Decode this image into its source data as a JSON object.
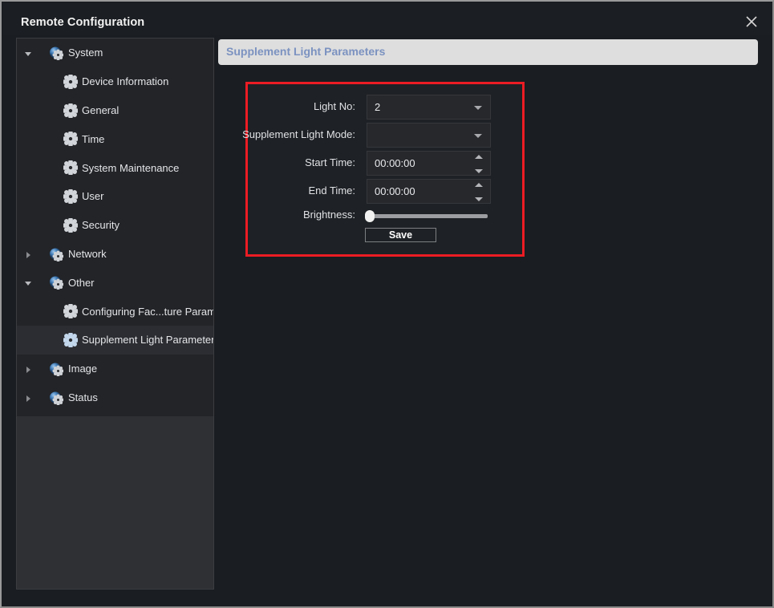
{
  "window": {
    "title": "Remote Configuration",
    "close_icon": "close-icon"
  },
  "sidebar": {
    "items": [
      {
        "label": "System",
        "level": 0,
        "expanded": true,
        "twisty": "chevron-down-icon",
        "icon": "sphere-gear-icon",
        "selected": false
      },
      {
        "label": "Device Information",
        "level": 1,
        "expanded": null,
        "twisty": "",
        "icon": "gear-icon",
        "selected": false
      },
      {
        "label": "General",
        "level": 1,
        "expanded": null,
        "twisty": "",
        "icon": "gear-icon",
        "selected": false
      },
      {
        "label": "Time",
        "level": 1,
        "expanded": null,
        "twisty": "",
        "icon": "gear-icon",
        "selected": false
      },
      {
        "label": "System Maintenance",
        "level": 1,
        "expanded": null,
        "twisty": "",
        "icon": "gear-icon",
        "selected": false
      },
      {
        "label": "User",
        "level": 1,
        "expanded": null,
        "twisty": "",
        "icon": "gear-icon",
        "selected": false
      },
      {
        "label": "Security",
        "level": 1,
        "expanded": null,
        "twisty": "",
        "icon": "gear-icon",
        "selected": false
      },
      {
        "label": "Network",
        "level": 0,
        "expanded": false,
        "twisty": "chevron-right-icon",
        "icon": "sphere-gear-icon",
        "selected": false
      },
      {
        "label": "Other",
        "level": 0,
        "expanded": true,
        "twisty": "chevron-down-icon",
        "icon": "sphere-gear-icon",
        "selected": false
      },
      {
        "label": "Configuring Fac...ture Parameters",
        "level": 1,
        "expanded": null,
        "twisty": "",
        "icon": "gear-icon",
        "selected": false
      },
      {
        "label": "Supplement Light Parameters",
        "level": 1,
        "expanded": null,
        "twisty": "",
        "icon": "gear-icon-blue",
        "selected": true
      },
      {
        "label": "Image",
        "level": 0,
        "expanded": false,
        "twisty": "chevron-right-icon",
        "icon": "sphere-gear-icon",
        "selected": false
      },
      {
        "label": "Status",
        "level": 0,
        "expanded": false,
        "twisty": "chevron-right-icon",
        "icon": "sphere-gear-icon",
        "selected": false
      }
    ]
  },
  "panel": {
    "header_title": "Supplement Light Parameters",
    "header_text_color": "#7b92c0",
    "highlight_border_color": "#ec1c24"
  },
  "form": {
    "light_no": {
      "label": "Light No:",
      "value": "2",
      "icon": "chevron-down-icon"
    },
    "supplement_light_mode": {
      "label": "Supplement Light Mode:",
      "value": "",
      "icon": "chevron-down-icon"
    },
    "start_time": {
      "label": "Start Time:",
      "value": "00:00:00",
      "icon": "spinner-icon"
    },
    "end_time": {
      "label": "End Time:",
      "value": "00:00:00",
      "icon": "spinner-icon"
    },
    "brightness": {
      "label": "Brightness:",
      "value": "0"
    },
    "save": {
      "label": "Save"
    }
  }
}
